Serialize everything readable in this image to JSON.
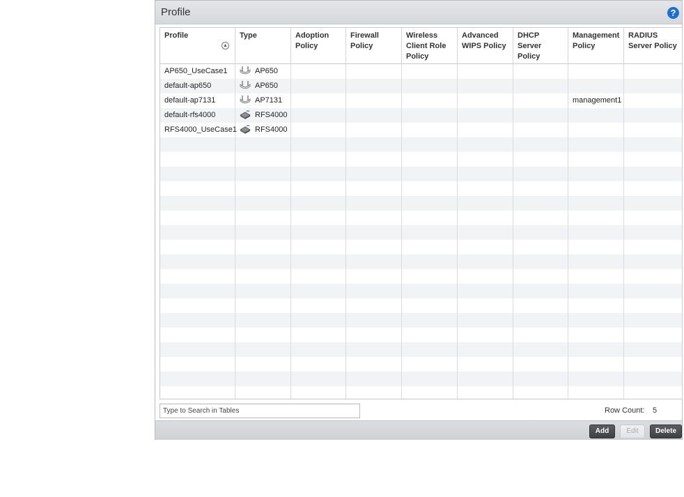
{
  "panel": {
    "title": "Profile",
    "help_icon": "?"
  },
  "table": {
    "columns": [
      {
        "label": "Profile"
      },
      {
        "label": "Type"
      },
      {
        "label": "Adoption Policy"
      },
      {
        "label": "Firewall Policy"
      },
      {
        "label": "Wireless Client Role Policy"
      },
      {
        "label": "Advanced WIPS Policy"
      },
      {
        "label": "DHCP Server Policy"
      },
      {
        "label": "Management Policy"
      },
      {
        "label": "RADIUS Server Policy"
      }
    ],
    "rows": [
      {
        "profile": "AP650_UseCase1",
        "type": "AP650",
        "type_icon": "access-point-icon",
        "adoption": "",
        "firewall": "",
        "wireless_client_role": "",
        "advanced_wips": "",
        "dhcp_server": "",
        "management": "",
        "radius_server": ""
      },
      {
        "profile": "default-ap650",
        "type": "AP650",
        "type_icon": "access-point-icon",
        "adoption": "",
        "firewall": "",
        "wireless_client_role": "",
        "advanced_wips": "",
        "dhcp_server": "",
        "management": "",
        "radius_server": ""
      },
      {
        "profile": "default-ap7131",
        "type": "AP7131",
        "type_icon": "access-point-icon",
        "adoption": "",
        "firewall": "",
        "wireless_client_role": "",
        "advanced_wips": "",
        "dhcp_server": "",
        "management": "management1",
        "radius_server": ""
      },
      {
        "profile": "default-rfs4000",
        "type": "RFS4000",
        "type_icon": "wireless-controller-icon",
        "adoption": "",
        "firewall": "",
        "wireless_client_role": "",
        "advanced_wips": "",
        "dhcp_server": "",
        "management": "",
        "radius_server": ""
      },
      {
        "profile": "RFS4000_UseCase1",
        "type": "RFS4000",
        "type_icon": "wireless-controller-icon",
        "adoption": "",
        "firewall": "",
        "wireless_client_role": "",
        "advanced_wips": "",
        "dhcp_server": "",
        "management": "",
        "radius_server": ""
      }
    ]
  },
  "search": {
    "placeholder": "Type to Search in Tables",
    "value": ""
  },
  "row_count": {
    "label": "Row Count:",
    "value": "5"
  },
  "buttons": {
    "add": "Add",
    "edit": "Edit",
    "delete": "Delete"
  },
  "colors": {
    "help_icon": "#1d6fd1",
    "row_alt": "#f2f3f5",
    "button_dark": "#4a4c50"
  }
}
